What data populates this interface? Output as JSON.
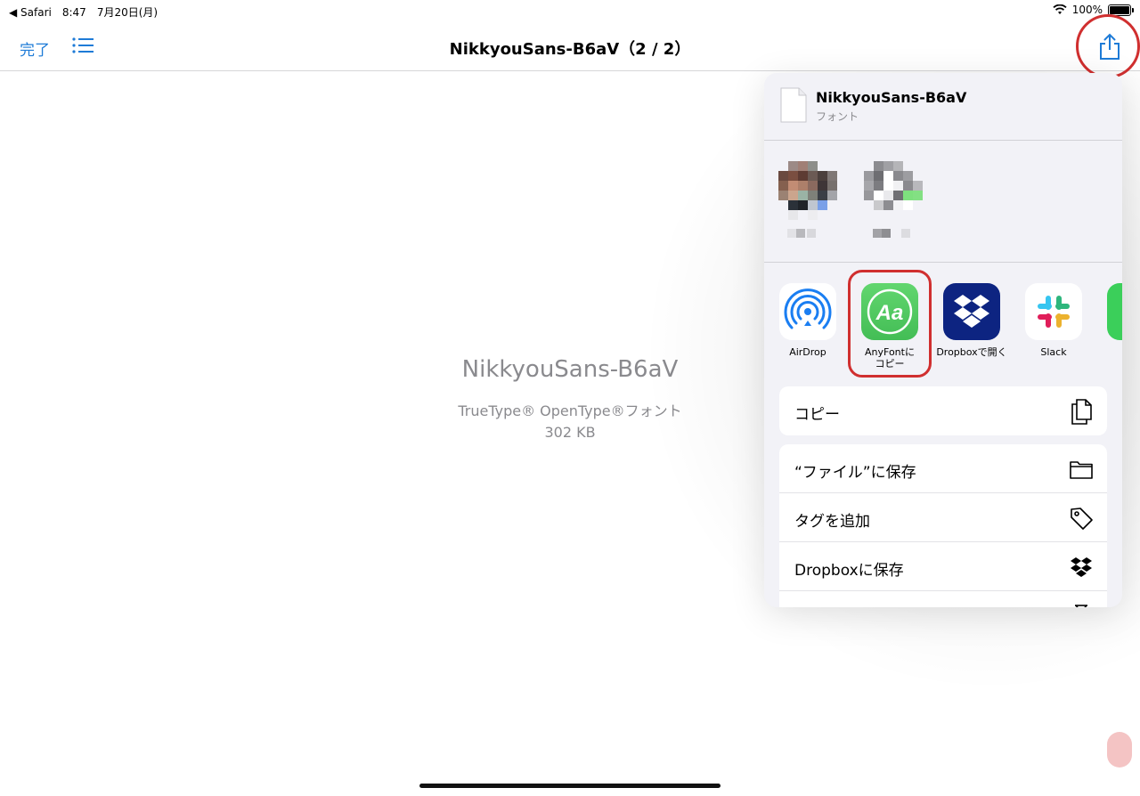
{
  "status_bar": {
    "back_app": "◀ Safari",
    "time": "8:47",
    "date": "7月20日(月)",
    "battery": "100%"
  },
  "nav": {
    "done_label": "完了",
    "title": "NikkyouSans-B6aV（2 / 2）"
  },
  "preview": {
    "font_name": "NikkyouSans-B6aV",
    "font_type": "TrueType® OpenType®フォント",
    "size": "302 KB"
  },
  "share_sheet": {
    "file_name": "NikkyouSans-B6aV",
    "file_kind": "フォント",
    "apps": [
      {
        "label": "AirDrop",
        "icon": "airdrop-icon"
      },
      {
        "label": "AnyFontに\nコピー",
        "icon": "anyfont-icon"
      },
      {
        "label": "Dropboxで開く",
        "icon": "dropbox-icon"
      },
      {
        "label": "Slack",
        "icon": "slack-icon"
      }
    ],
    "actions_group1": [
      {
        "label": "コピー",
        "icon": "copy-icon"
      }
    ],
    "actions_group2": [
      {
        "label": "“ファイル”に保存",
        "icon": "folder-icon"
      },
      {
        "label": "タグを追加",
        "icon": "tag-icon"
      },
      {
        "label": "Dropboxに保存",
        "icon": "dropbox-icon"
      }
    ]
  },
  "colors": {
    "accent": "#1e7bd7",
    "highlight_ring": "#d02f2f",
    "anyfont_green": "#4cc864",
    "dropbox_navy": "#0d2481"
  }
}
